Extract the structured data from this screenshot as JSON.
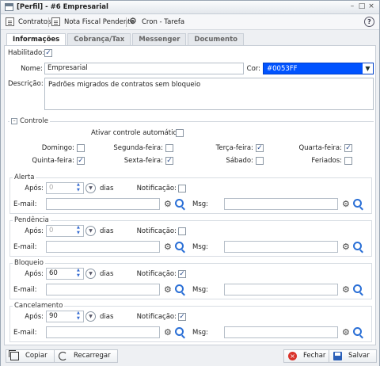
{
  "window": {
    "title": "[Perfil] - #6 Empresarial",
    "min": "–",
    "restore": "□",
    "close": "×"
  },
  "toolbar": {
    "contratos": "Contratos",
    "nfp": "Nota Fiscal Pendente",
    "cron": "Cron - Tarefa",
    "help": "?"
  },
  "tabs": [
    "Informações",
    "Cobrança/Tax",
    "Messenger",
    "Documento"
  ],
  "form": {
    "habilitado_label": "Habilitado:",
    "habilitado": "✓",
    "nome_label": "Nome:",
    "nome_value": "Empresarial",
    "cor_label": "Cor:",
    "cor_value": "#0053FF",
    "cor_color": "#0053ff",
    "descricao_label": "Descrição:",
    "descricao_value": "Padrões migrados de contratos sem bloqueio"
  },
  "controle": {
    "legend": "Controle",
    "collapse": "–",
    "auto_label": "Ativar controle automático:",
    "days": {
      "domingo": "Domingo:",
      "segunda": "Segunda-feira:",
      "terca": "Terça-feira:",
      "quarta": "Quarta-feira:",
      "quinta": "Quinta-feira:",
      "sexta": "Sexta-feira:",
      "sabado": "Sábado:",
      "feriados": "Feriados:"
    },
    "check": "✓"
  },
  "sections": [
    {
      "title": "Alerta",
      "apos_label": "Após:",
      "apos_value": "0",
      "dias": "dias",
      "notif_label": "Notificação:",
      "email_label": "E-mail:",
      "msg_label": "Msg:"
    },
    {
      "title": "Pendência",
      "apos_label": "Após:",
      "apos_value": "0",
      "dias": "dias",
      "notif_label": "Notificação:",
      "email_label": "E-mail:",
      "msg_label": "Msg:"
    },
    {
      "title": "Bloqueio",
      "apos_label": "Após:",
      "apos_value": "60",
      "dias": "dias",
      "notif_label": "Notificação:",
      "email_label": "E-mail:",
      "msg_label": "Msg:"
    },
    {
      "title": "Cancelamento",
      "apos_label": "Após:",
      "apos_value": "90",
      "dias": "dias",
      "notif_label": "Notificação:",
      "email_label": "E-mail:",
      "msg_label": "Msg:"
    }
  ],
  "footer": {
    "copiar": "Copiar",
    "recarregar": "Recarregar",
    "fechar": "Fechar",
    "salvar": "Salvar"
  }
}
